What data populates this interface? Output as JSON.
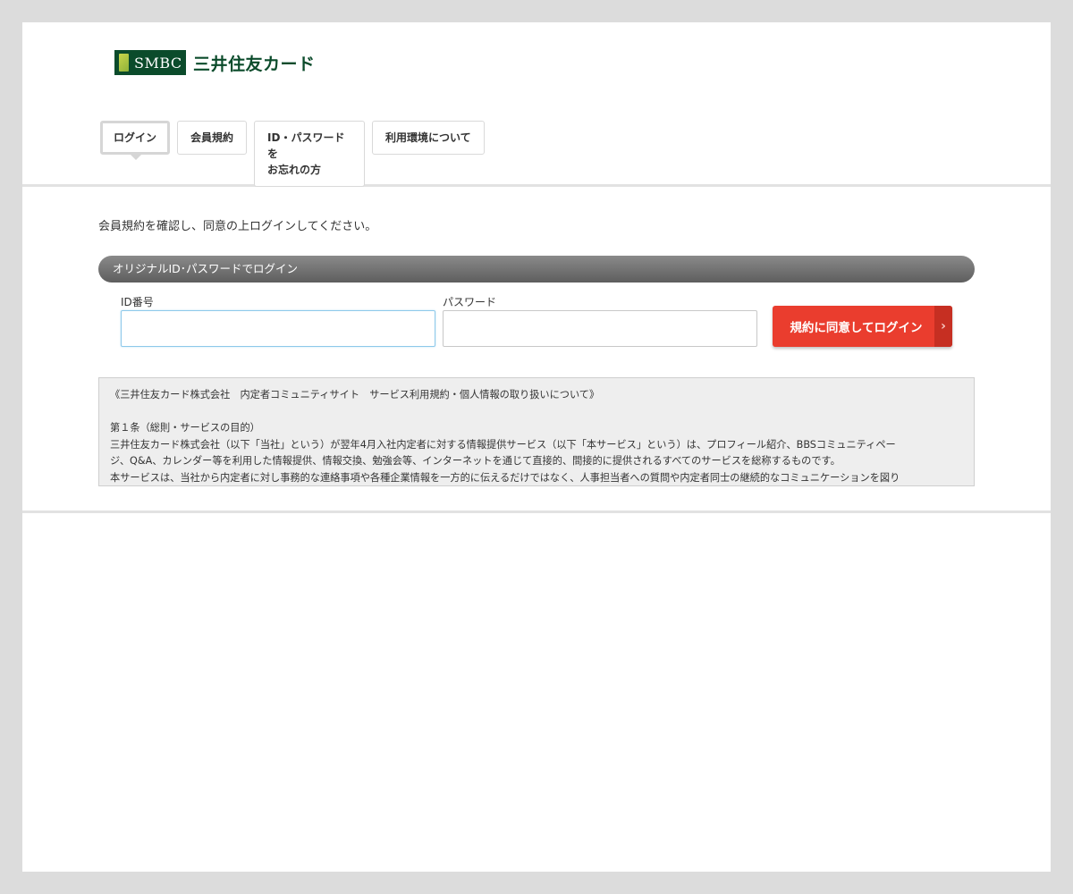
{
  "brand": {
    "logo_text": "SMBC",
    "company_name": "三井住友カード",
    "colors": {
      "brand_green": "#0b4b2b",
      "accent_red": "#ea3d2e",
      "focus_blue": "#8ec9ea"
    }
  },
  "nav": {
    "tabs": [
      {
        "label": "ログイン",
        "active": true
      },
      {
        "label": "会員規約",
        "active": false
      },
      {
        "label_line1": "ID・パスワードを",
        "label_line2": "お忘れの方",
        "active": false
      },
      {
        "label": "利用環境について",
        "active": false
      }
    ]
  },
  "main": {
    "intro": "会員規約を確認し、同意の上ログインしてください。",
    "section_title": "オリジナルID･パスワードでログイン",
    "id_label": "ID番号",
    "id_value": "",
    "password_label": "パスワード",
    "password_value": "",
    "login_button": "規約に同意してログイン",
    "login_button_icon": "chevron-right-icon",
    "login_button_arrow": "›"
  },
  "terms": {
    "title": "《三井住友カード株式会社　内定者コミュニティサイト　サービス利用規約・個人情報の取り扱いについて》",
    "article1_heading": "第１条（総則・サービスの目的）",
    "article1_line1": "三井住友カード株式会社（以下「当社」という）が翌年4月入社内定者に対する情報提供サービス（以下「本サービス」という）は、プロフィール紹介、BBSコミュニティペー",
    "article1_line2": "ジ、Q&A、カレンダー等を利用した情報提供、情報交換、勉強会等、インターネットを通じて直接的、間接的に提供されるすべてのサービスを総称するものです。",
    "article1_line3": "本サービスは、当社から内定者に対し事務的な連絡事項や各種企業情報を一方的に伝えるだけではなく、人事担当者への質問や内定者同士の継続的なコミュニケーションを図り"
  }
}
